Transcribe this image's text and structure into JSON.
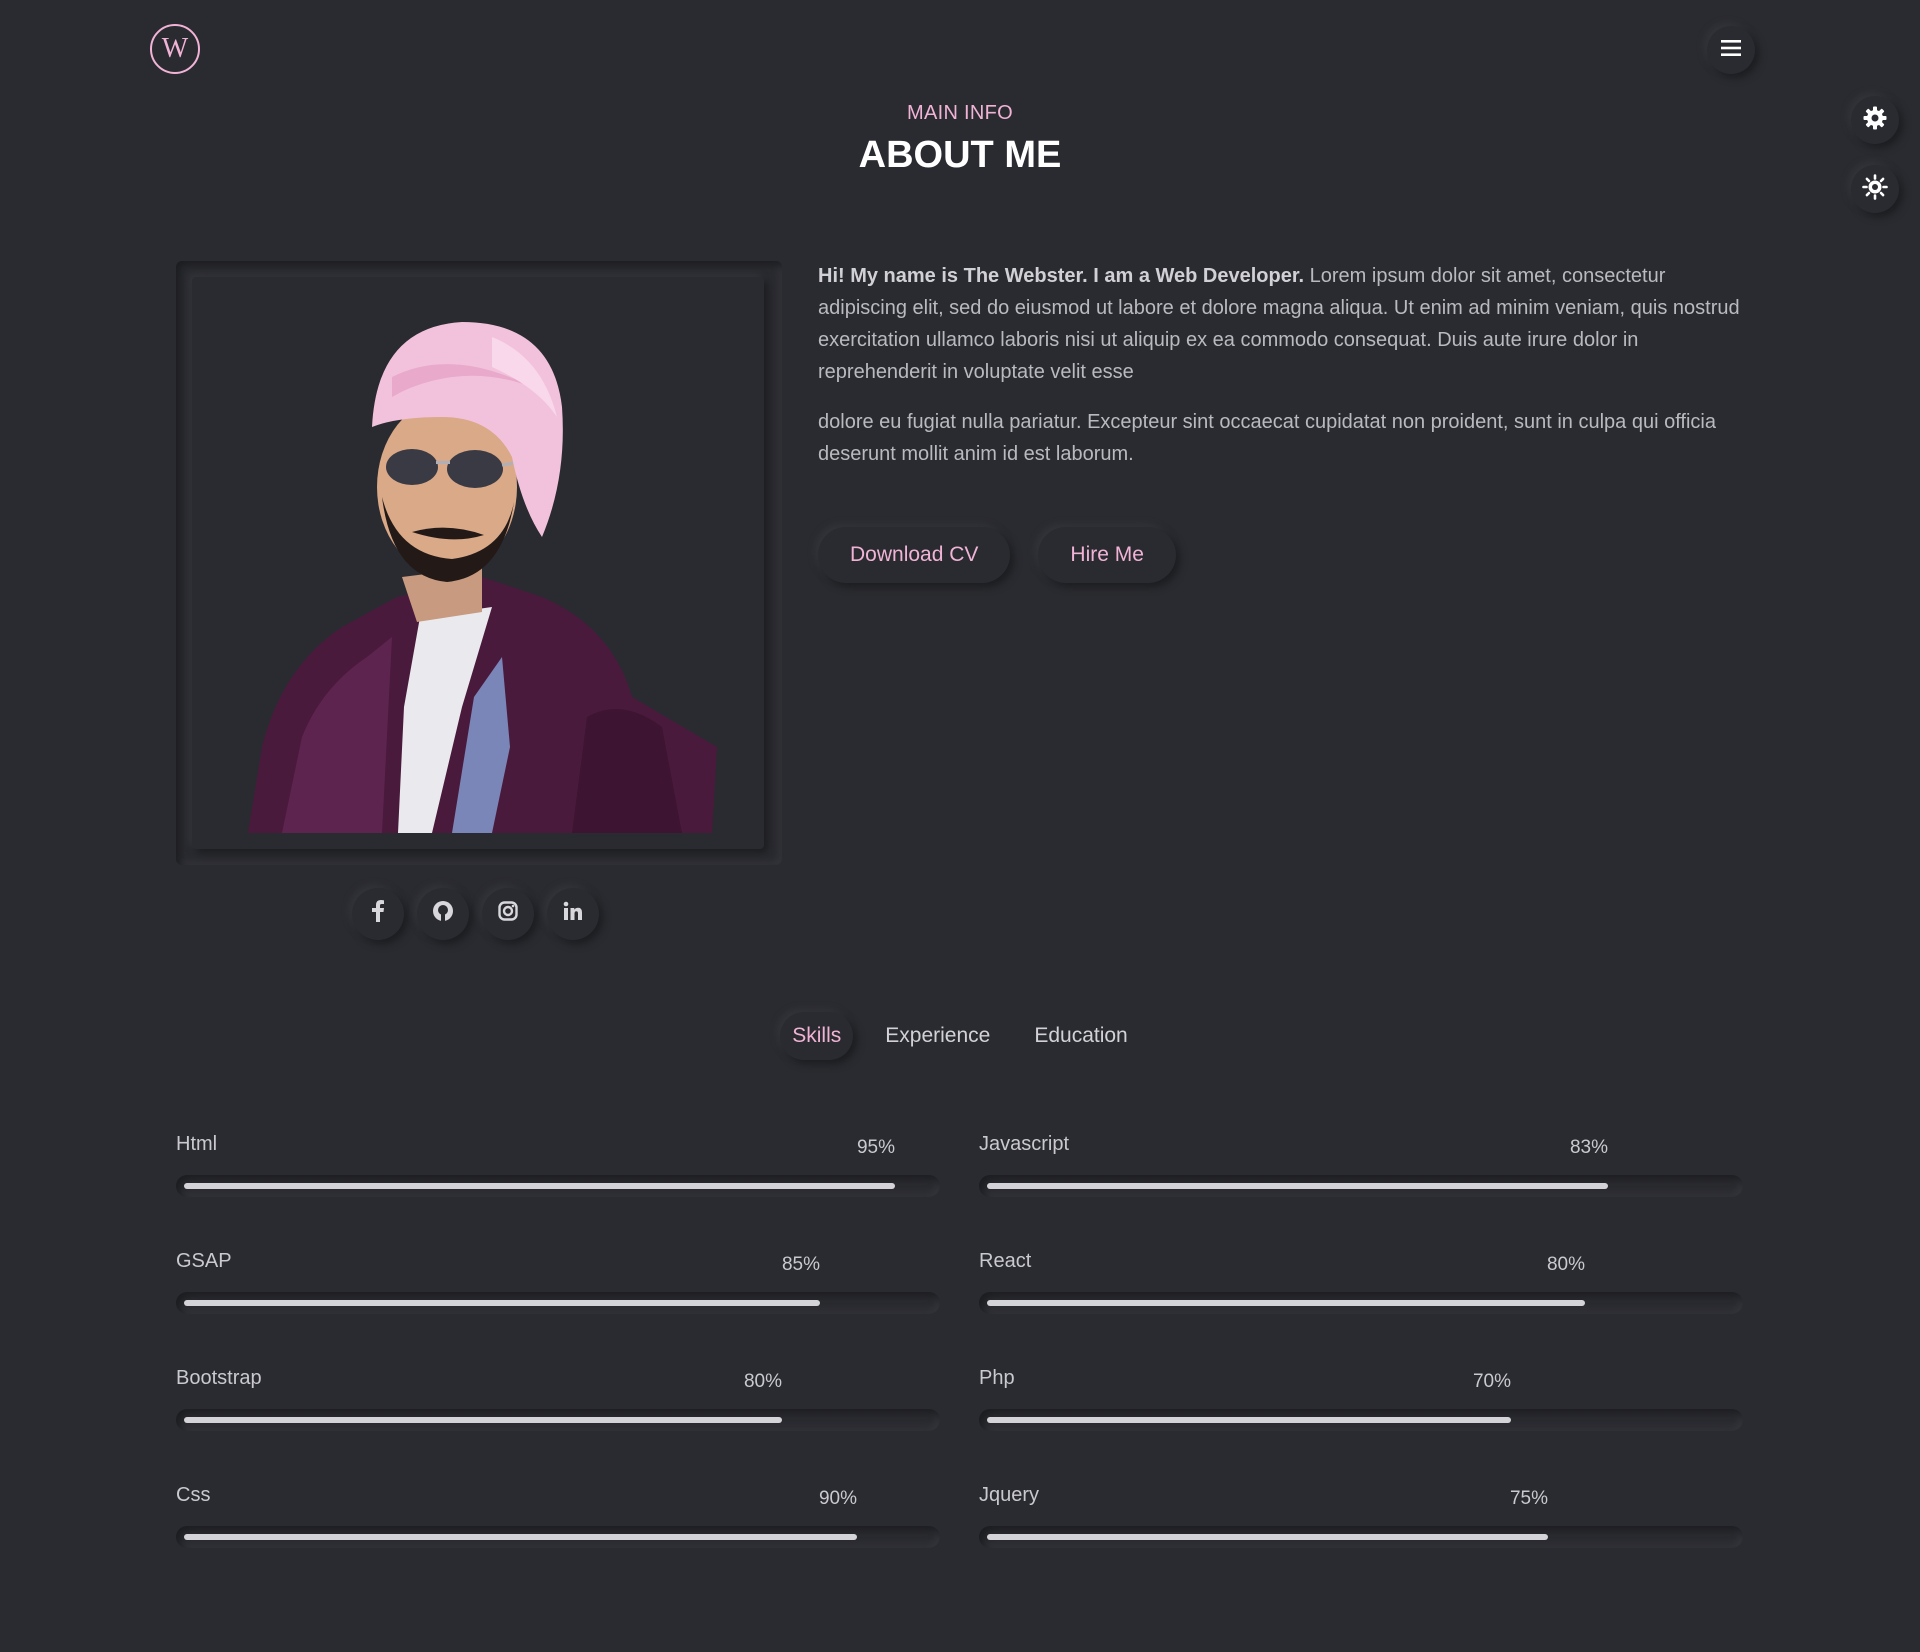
{
  "header": {
    "logo_letter": "W",
    "menu_icon": "hamburger-icon"
  },
  "side_controls": {
    "settings_icon": "gear-icon",
    "theme_icon": "sun-icon"
  },
  "section": {
    "subtitle": "MAIN INFO",
    "title": "ABOUT ME"
  },
  "about": {
    "intro_bold": "Hi! My name is The Webster. I am a Web Developer.",
    "intro_rest": " Lorem ipsum dolor sit amet, consectetur adipiscing elit, sed do eiusmod ut labore et dolore magna aliqua. Ut enim ad minim veniam, quis nostrud exercitation ullamco laboris nisi ut aliquip ex ea commodo consequat. Duis aute irure dolor in reprehenderit in voluptate velit esse",
    "paragraph2": "dolore eu fugiat nulla pariatur. Excepteur sint occaecat cupidatat non proident, sunt in culpa qui officia deserunt mollit anim id est laborum.",
    "download_label": "Download CV",
    "hire_label": "Hire Me"
  },
  "socials": [
    {
      "icon": "facebook-icon",
      "glyph": "f"
    },
    {
      "icon": "github-icon",
      "glyph": ""
    },
    {
      "icon": "instagram-icon",
      "glyph": ""
    },
    {
      "icon": "linkedin-icon",
      "glyph": "in"
    }
  ],
  "tabs": [
    {
      "label": "Skills",
      "active": true
    },
    {
      "label": "Experience",
      "active": false
    },
    {
      "label": "Education",
      "active": false
    }
  ],
  "skills_left": [
    {
      "name": "Html",
      "percent_label": "95%",
      "value": 95
    },
    {
      "name": "GSAP",
      "percent_label": "85%",
      "value": 85
    },
    {
      "name": "Bootstrap",
      "percent_label": "80%",
      "value": 80
    },
    {
      "name": "Css",
      "percent_label": "90%",
      "value": 90
    }
  ],
  "skills_right": [
    {
      "name": "Javascript",
      "percent_label": "83%",
      "value": 83
    },
    {
      "name": "React",
      "percent_label": "80%",
      "value": 80
    },
    {
      "name": "Php",
      "percent_label": "70%",
      "value": 70
    },
    {
      "name": "Jquery",
      "percent_label": "75%",
      "value": 75
    }
  ],
  "colors": {
    "background": "#2a2b30",
    "accent": "#f0b3d6",
    "text": "#c9c9cf",
    "bar": "#d4d4d8"
  }
}
